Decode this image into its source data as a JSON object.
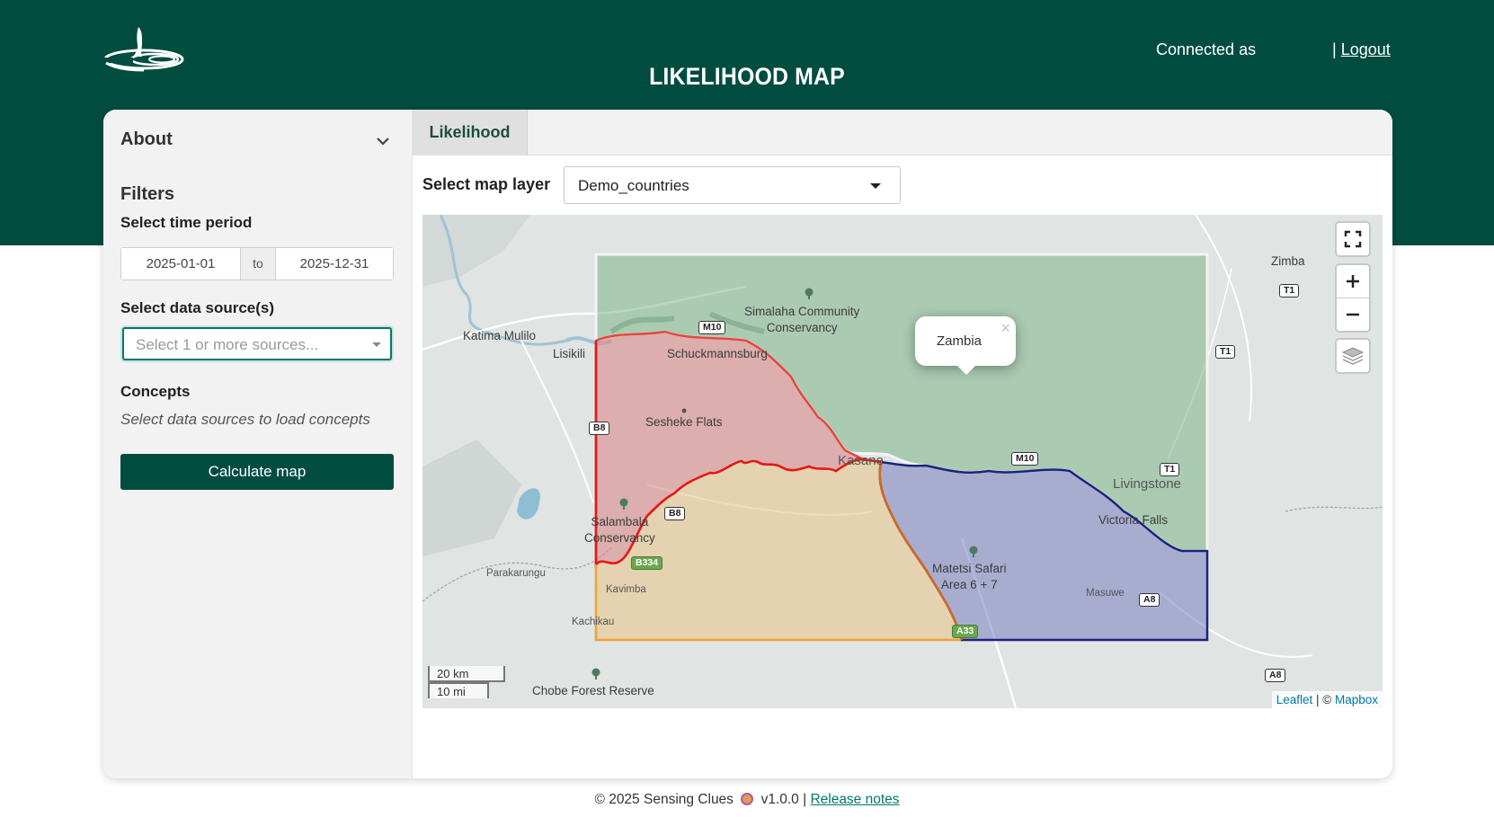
{
  "header": {
    "title": "LIKELIHOOD MAP",
    "connected_label": "Connected as",
    "separator": "|",
    "logout_label": "Logout",
    "bg_color": "#004d40"
  },
  "sidebar": {
    "about_label": "About",
    "filters_title": "Filters",
    "time_period_label": "Select time period",
    "date_from": "2025-01-01",
    "date_to_sep": "to",
    "date_to": "2025-12-31",
    "data_source_label": "Select data source(s)",
    "data_source_placeholder": "Select 1 or more sources...",
    "concepts_label": "Concepts",
    "concepts_hint": "Select data sources to load concepts",
    "calculate_button": "Calculate map"
  },
  "tabs": [
    {
      "label": "Likelihood",
      "active": true
    }
  ],
  "map_controls": {
    "layer_label": "Select map layer",
    "layer_value": "Demo_countries"
  },
  "map": {
    "popup_text": "Zambia",
    "places": {
      "simalaha": "Simalaha Community\nConservancy",
      "katima": "Katima Mulilo",
      "lisikili": "Lisikili",
      "schuckmannsburg": "Schuckmannsburg",
      "sesheke": "Sesheke Flats",
      "kasane": "Kasane",
      "livingstone": "Livingstone",
      "victoria": "Victoria Falls",
      "salambala": "Salambala\nConservancy",
      "matetsi": "Matetsi Safari\nArea 6 + 7",
      "parakarungu": "Parakarungu",
      "kavimba": "Kavimba",
      "kachikau": "Kachikau",
      "masuwe": "Masuwe",
      "chobe": "Chobe Forest Reserve",
      "zimba": "Zimba"
    },
    "roads": {
      "m10_a": "M10",
      "m10_b": "M10",
      "t1_a": "T1",
      "t1_b": "T1",
      "t1_c": "T1",
      "b8_a": "B8",
      "b8_b": "B8",
      "b334": "B334",
      "a8_a": "A8",
      "a8_b": "A8",
      "a33": "A33"
    },
    "scale_km": "20 km",
    "scale_mi": "10 mi",
    "attribution_leaflet": "Leaflet",
    "attribution_sep": " | © ",
    "attribution_mapbox": "Mapbox",
    "country_colors": {
      "zambia": "#7fb58a",
      "namibia": "#d98a8a",
      "botswana": "#e8c690",
      "zimbabwe": "#8288c4"
    }
  },
  "footer": {
    "copyright": "© 2025 Sensing Clues",
    "version": "v1.0.0 |",
    "release_notes": "Release notes"
  }
}
